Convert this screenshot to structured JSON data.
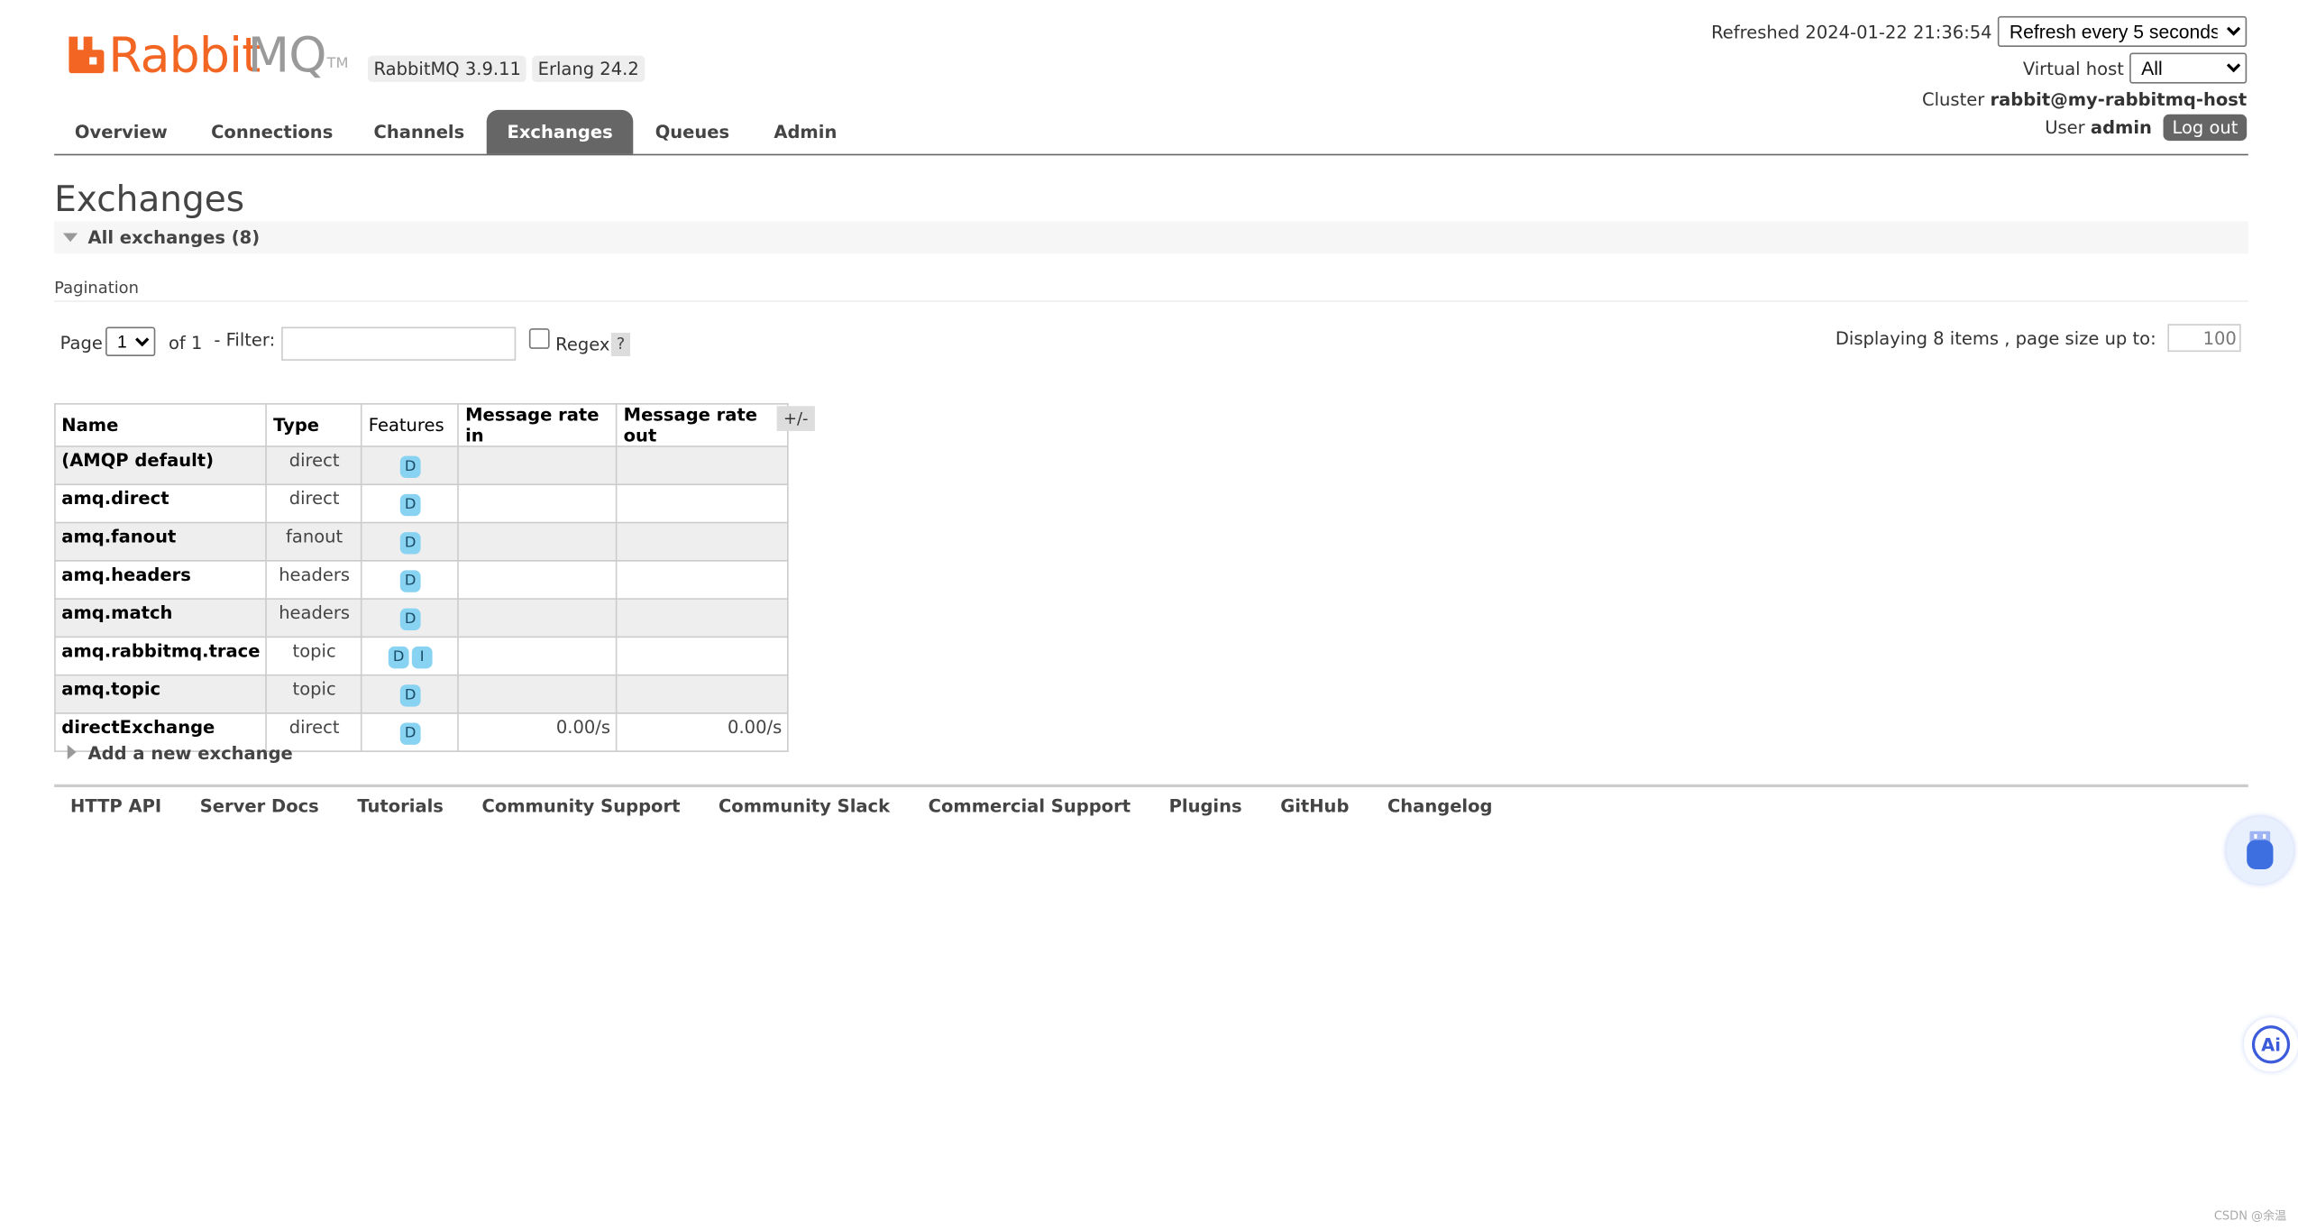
{
  "header": {
    "logo_word1": "Rabbit",
    "logo_word2": "MQ",
    "logo_tm": "TM",
    "rabbitmq_version": "RabbitMQ 3.9.11",
    "erlang_version": "Erlang 24.2"
  },
  "top_right": {
    "refreshed_label": "Refreshed",
    "refreshed_time": "2024-01-22 21:36:54",
    "refresh_select": "Refresh every 5 seconds",
    "vhost_label": "Virtual host",
    "vhost_select": "All",
    "cluster_label": "Cluster",
    "cluster_value": "rabbit@my-rabbitmq-host",
    "user_label": "User",
    "user_value": "admin",
    "logout_label": "Log out"
  },
  "tabs": [
    {
      "label": "Overview",
      "active": false
    },
    {
      "label": "Connections",
      "active": false
    },
    {
      "label": "Channels",
      "active": false
    },
    {
      "label": "Exchanges",
      "active": true
    },
    {
      "label": "Queues",
      "active": false
    },
    {
      "label": "Admin",
      "active": false
    }
  ],
  "page_title": "Exchanges",
  "section_label": "All exchanges (8)",
  "pagination": {
    "label": "Pagination",
    "page_label": "Page",
    "page_value": "1",
    "of_label": "of 1",
    "filter_label": "- Filter:",
    "filter_value": "",
    "regex_label": "Regex",
    "help_label": "?",
    "display_text": "Displaying 8 items , page size up to:",
    "page_size": "100"
  },
  "table": {
    "headers": [
      "Name",
      "Type",
      "Features",
      "Message rate in",
      "Message rate out"
    ],
    "plus_minus": "+/-",
    "rows": [
      {
        "name": "(AMQP default)",
        "type": "direct",
        "features": [
          "D"
        ],
        "rate_in": "",
        "rate_out": ""
      },
      {
        "name": "amq.direct",
        "type": "direct",
        "features": [
          "D"
        ],
        "rate_in": "",
        "rate_out": ""
      },
      {
        "name": "amq.fanout",
        "type": "fanout",
        "features": [
          "D"
        ],
        "rate_in": "",
        "rate_out": ""
      },
      {
        "name": "amq.headers",
        "type": "headers",
        "features": [
          "D"
        ],
        "rate_in": "",
        "rate_out": ""
      },
      {
        "name": "amq.match",
        "type": "headers",
        "features": [
          "D"
        ],
        "rate_in": "",
        "rate_out": ""
      },
      {
        "name": "amq.rabbitmq.trace",
        "type": "topic",
        "features": [
          "D",
          "I"
        ],
        "rate_in": "",
        "rate_out": ""
      },
      {
        "name": "amq.topic",
        "type": "topic",
        "features": [
          "D"
        ],
        "rate_in": "",
        "rate_out": ""
      },
      {
        "name": "directExchange",
        "type": "direct",
        "features": [
          "D"
        ],
        "rate_in": "0.00/s",
        "rate_out": "0.00/s"
      }
    ]
  },
  "add_exchange_label": "Add a new exchange",
  "footer_links": [
    "HTTP API",
    "Server Docs",
    "Tutorials",
    "Community Support",
    "Community Slack",
    "Commercial Support",
    "Plugins",
    "GitHub",
    "Changelog"
  ],
  "widgets": {
    "ai_label": "Ai"
  },
  "watermark": "CSDN @余温",
  "colors": {
    "brand_orange": "#f26522",
    "active_tab": "#666666",
    "badge": "#88d2f2"
  }
}
